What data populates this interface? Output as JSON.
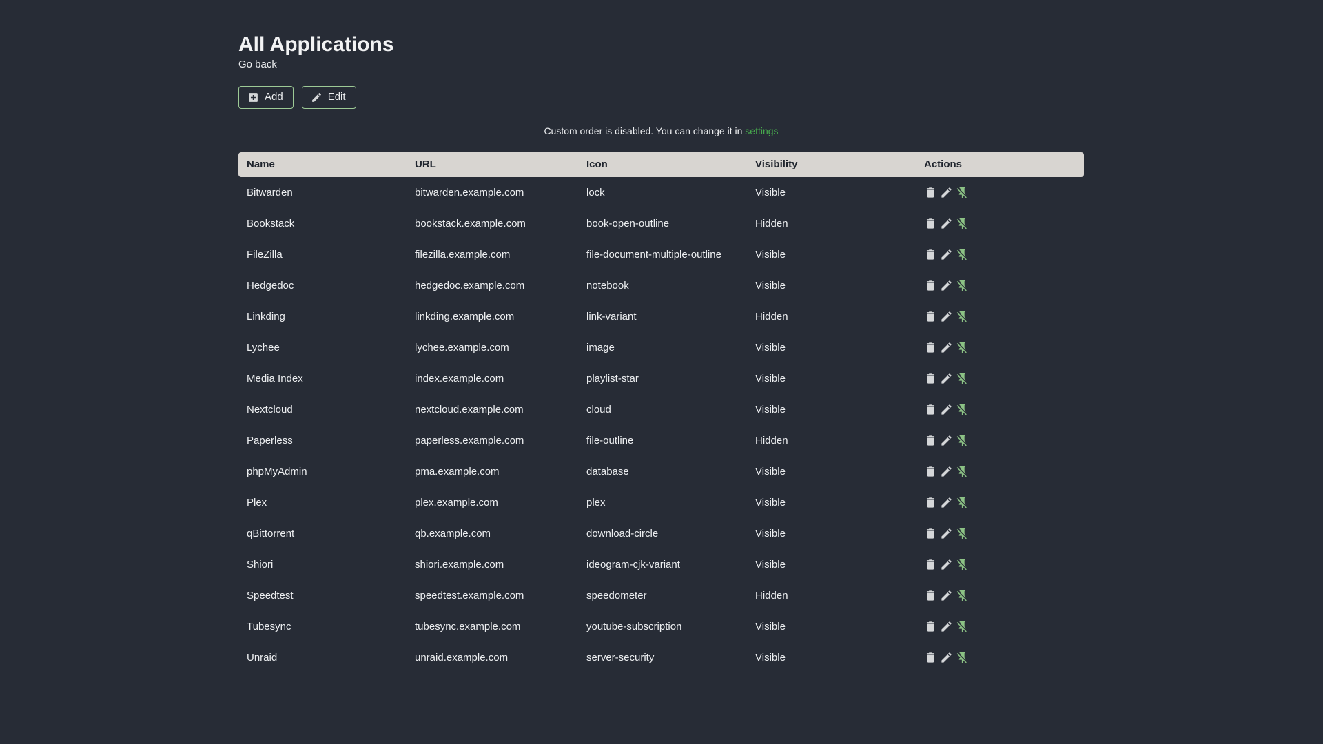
{
  "page": {
    "title": "All Applications",
    "back_label": "Go back",
    "add_label": "Add",
    "edit_label": "Edit",
    "notice_text": "Custom order is disabled. You can change it in",
    "notice_link": "settings"
  },
  "colors": {
    "background": "#272c36",
    "text": "#eceef0",
    "header_bg": "#d8d5d1",
    "header_text": "#20252e",
    "button_border_green": "#9dca96",
    "link_green": "#47a84d",
    "pin_icon_green": "#8cc285",
    "icon_gray": "#d5d7d9"
  },
  "icons": {
    "add_button": "plus-box-icon",
    "edit_button": "pencil-icon",
    "row_actions": [
      "delete-icon",
      "pencil-icon",
      "pin-off-icon"
    ]
  },
  "table": {
    "columns": [
      "Name",
      "URL",
      "Icon",
      "Visibility",
      "Actions"
    ],
    "rows": [
      {
        "name": "Bitwarden",
        "url": "bitwarden.example.com",
        "icon": "lock",
        "visibility": "Visible"
      },
      {
        "name": "Bookstack",
        "url": "bookstack.example.com",
        "icon": "book-open-outline",
        "visibility": "Hidden"
      },
      {
        "name": "FileZilla",
        "url": "filezilla.example.com",
        "icon": "file-document-multiple-outline",
        "visibility": "Visible"
      },
      {
        "name": "Hedgedoc",
        "url": "hedgedoc.example.com",
        "icon": "notebook",
        "visibility": "Visible"
      },
      {
        "name": "Linkding",
        "url": "linkding.example.com",
        "icon": "link-variant",
        "visibility": "Hidden"
      },
      {
        "name": "Lychee",
        "url": "lychee.example.com",
        "icon": "image",
        "visibility": "Visible"
      },
      {
        "name": "Media Index",
        "url": "index.example.com",
        "icon": "playlist-star",
        "visibility": "Visible"
      },
      {
        "name": "Nextcloud",
        "url": "nextcloud.example.com",
        "icon": "cloud",
        "visibility": "Visible"
      },
      {
        "name": "Paperless",
        "url": "paperless.example.com",
        "icon": "file-outline",
        "visibility": "Hidden"
      },
      {
        "name": "phpMyAdmin",
        "url": "pma.example.com",
        "icon": "database",
        "visibility": "Visible"
      },
      {
        "name": "Plex",
        "url": "plex.example.com",
        "icon": "plex",
        "visibility": "Visible"
      },
      {
        "name": "qBittorrent",
        "url": "qb.example.com",
        "icon": "download-circle",
        "visibility": "Visible"
      },
      {
        "name": "Shiori",
        "url": "shiori.example.com",
        "icon": "ideogram-cjk-variant",
        "visibility": "Visible"
      },
      {
        "name": "Speedtest",
        "url": "speedtest.example.com",
        "icon": "speedometer",
        "visibility": "Hidden"
      },
      {
        "name": "Tubesync",
        "url": "tubesync.example.com",
        "icon": "youtube-subscription",
        "visibility": "Visible"
      },
      {
        "name": "Unraid",
        "url": "unraid.example.com",
        "icon": "server-security",
        "visibility": "Visible"
      }
    ]
  }
}
